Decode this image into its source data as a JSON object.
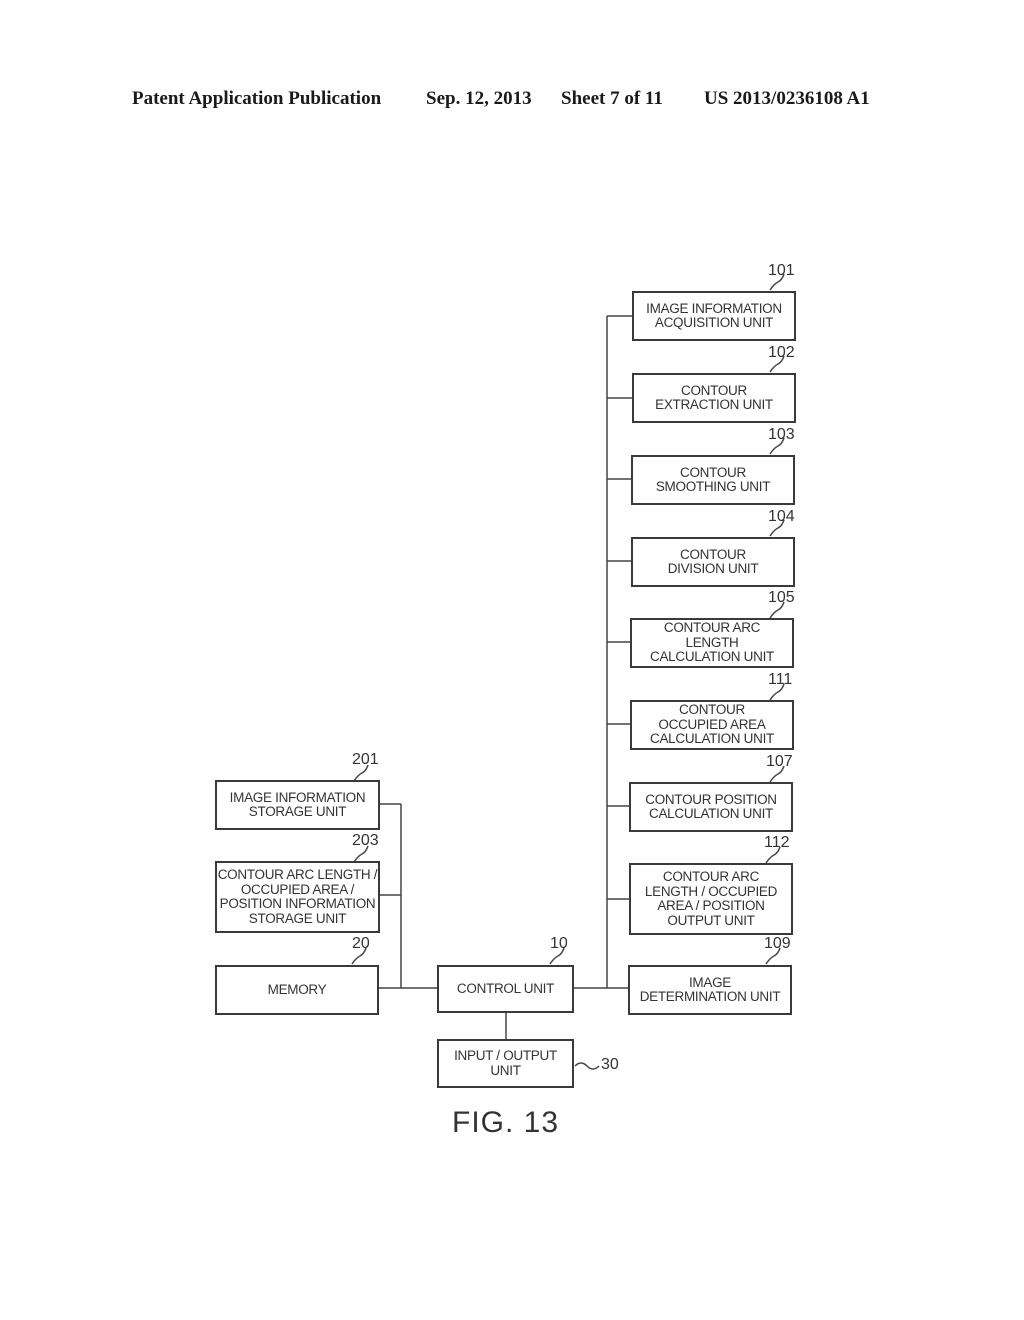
{
  "header": {
    "publication": "Patent Application Publication",
    "date": "Sep. 12, 2013",
    "sheet": "Sheet 7 of 11",
    "number": "US 2013/0236108 A1"
  },
  "figure": {
    "caption": "FIG. 13",
    "right_units": [
      {
        "ref": "101",
        "label": "IMAGE INFORMATION\nACQUISITION UNIT"
      },
      {
        "ref": "102",
        "label": "CONTOUR\nEXTRACTION UNIT"
      },
      {
        "ref": "103",
        "label": "CONTOUR\nSMOOTHING UNIT"
      },
      {
        "ref": "104",
        "label": "CONTOUR\nDIVISION UNIT"
      },
      {
        "ref": "105",
        "label": "CONTOUR ARC\nLENGTH\nCALCULATION UNIT"
      },
      {
        "ref": "111",
        "label": "CONTOUR\nOCCUPIED AREA\nCALCULATION UNIT"
      },
      {
        "ref": "107",
        "label": "CONTOUR POSITION\nCALCULATION UNIT"
      },
      {
        "ref": "112",
        "label": "CONTOUR ARC\nLENGTH / OCCUPIED\nAREA / POSITION\nOUTPUT UNIT"
      },
      {
        "ref": "109",
        "label": "IMAGE\nDETERMINATION UNIT"
      }
    ],
    "left_units": [
      {
        "ref": "201",
        "label": "IMAGE INFORMATION\nSTORAGE UNIT"
      },
      {
        "ref": "203",
        "label": "CONTOUR ARC LENGTH /\nOCCUPIED AREA /\nPOSITION INFORMATION\nSTORAGE UNIT"
      },
      {
        "ref": "20",
        "label": "MEMORY"
      }
    ],
    "control": {
      "ref": "10",
      "label": "CONTROL UNIT"
    },
    "io": {
      "ref": "30",
      "label": "INPUT / OUTPUT\nUNIT"
    }
  }
}
